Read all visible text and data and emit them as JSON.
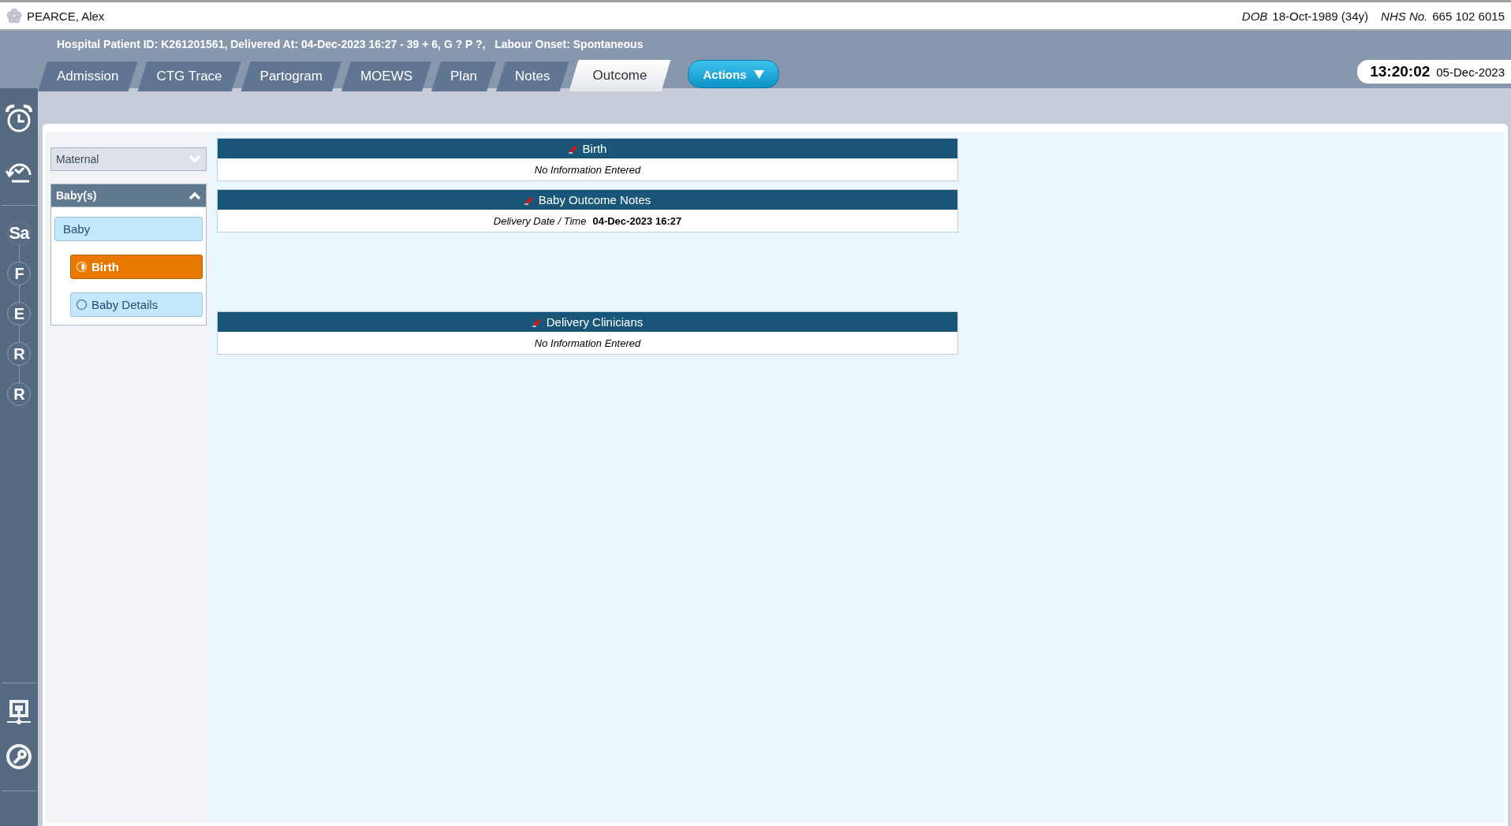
{
  "patient": {
    "name": "PEARCE, Alex",
    "dob_label": "DOB",
    "dob": "18-Oct-1989 (34y)",
    "nhs_label": "NHS No.",
    "nhs": "665 102 6015"
  },
  "summary": "Hospital Patient ID: K261201561, Delivered At: 04-Dec-2023 16:27 - 39 + 6, G ? P ?,   Labour Onset: Spontaneous",
  "tabs": [
    {
      "label": "Admission",
      "selected": false
    },
    {
      "label": "CTG Trace",
      "selected": false
    },
    {
      "label": "Partogram",
      "selected": false
    },
    {
      "label": "MOEWS",
      "selected": false
    },
    {
      "label": "Plan",
      "selected": false
    },
    {
      "label": "Notes",
      "selected": false
    },
    {
      "label": "Outcome",
      "selected": true
    }
  ],
  "actions_button": "Actions",
  "clock": {
    "time": "13:20:02",
    "date": "05-Dec-2023"
  },
  "rail": {
    "steps": [
      "Sa",
      "F",
      "E",
      "R",
      "R"
    ]
  },
  "nav": [
    {
      "label": "Maternal",
      "expanded": false
    },
    {
      "label": "Baby(s)",
      "expanded": true,
      "items": [
        {
          "label": "Baby",
          "children": [
            {
              "label": "Birth",
              "selected": true,
              "kind": "partial"
            },
            {
              "label": "Baby Details",
              "selected": false,
              "kind": "empty"
            }
          ]
        }
      ]
    }
  ],
  "sections": [
    {
      "title": "Birth",
      "empty_text": "No Information Entered"
    },
    {
      "title": "Baby Outcome Notes",
      "fields": [
        {
          "label": "Delivery Date / Time",
          "value": "04-Dec-2023 16:27"
        }
      ]
    },
    {
      "title": "Delivery Clinicians",
      "empty_text": "No Information Entered"
    }
  ]
}
